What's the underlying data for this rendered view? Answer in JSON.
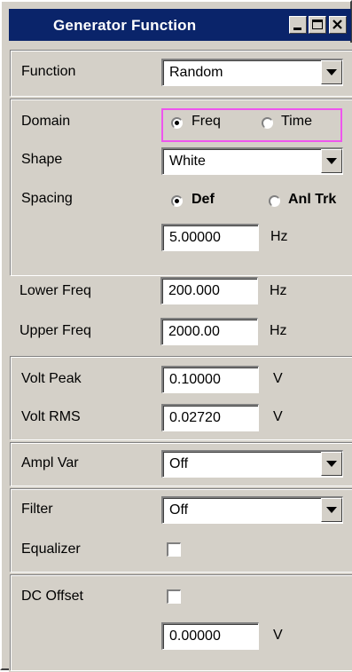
{
  "window": {
    "title": "Generator Function",
    "title_bar_color": "#0a246a",
    "buttons": [
      "minimize-icon",
      "maximize-icon",
      "close-icon"
    ]
  },
  "function": {
    "label": "Function",
    "value": "Random"
  },
  "domain": {
    "label": "Domain",
    "options": [
      "Freq",
      "Time"
    ],
    "selected": "Freq",
    "highlight_color": "#ee55ee"
  },
  "shape": {
    "label": "Shape",
    "value": "White"
  },
  "spacing": {
    "label": "Spacing",
    "options": [
      "Def",
      "Anl Trk"
    ],
    "selected": "Def",
    "value": "5.00000",
    "unit": "Hz"
  },
  "lower_freq": {
    "label": "Lower Freq",
    "value": "200.000",
    "unit": "Hz"
  },
  "upper_freq": {
    "label": "Upper Freq",
    "value": "2000.00",
    "unit": "Hz"
  },
  "volt_peak": {
    "label": "Volt Peak",
    "value": "0.10000",
    "unit": "V"
  },
  "volt_rms": {
    "label": "Volt RMS",
    "value": "0.02720",
    "unit": "V"
  },
  "ampl_var": {
    "label": "Ampl Var",
    "value": "Off"
  },
  "filter": {
    "label": "Filter",
    "value": "Off"
  },
  "equalizer": {
    "label": "Equalizer",
    "checked": false
  },
  "dc_offset": {
    "label": "DC Offset",
    "checked": false,
    "value": "0.00000",
    "unit": "V"
  }
}
